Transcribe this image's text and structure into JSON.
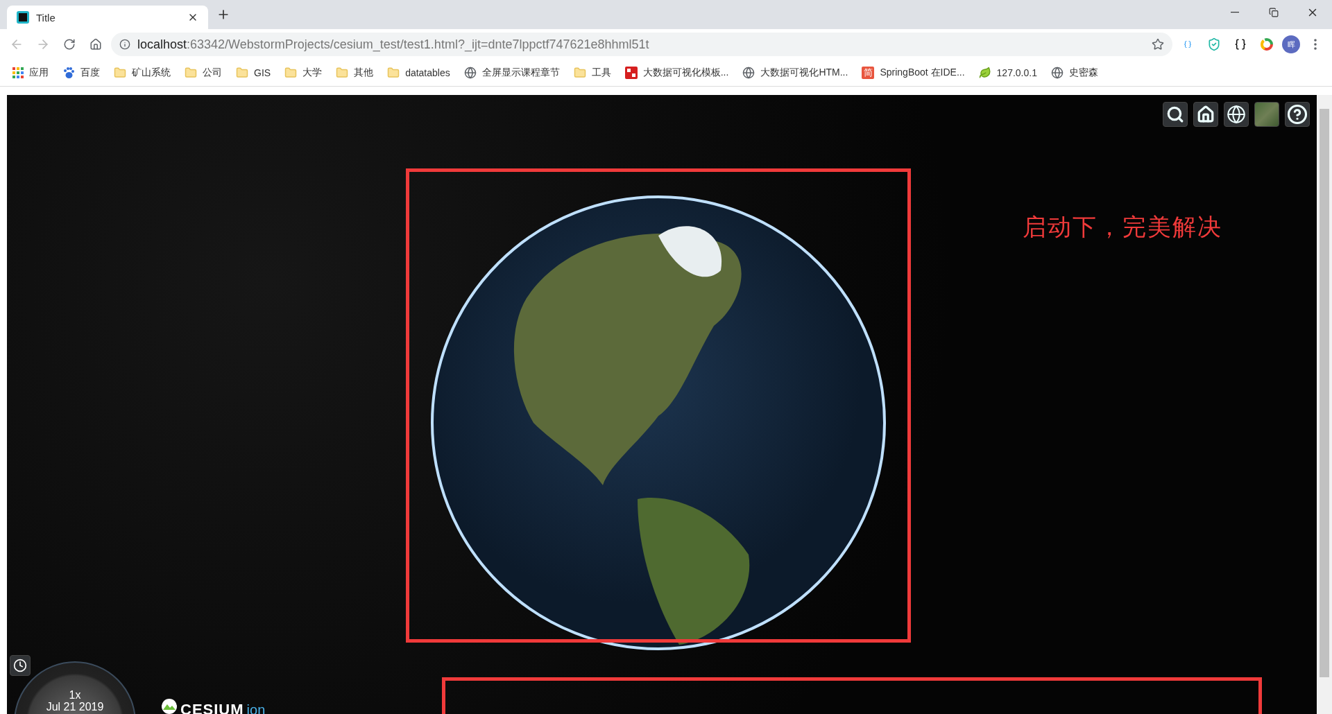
{
  "browser": {
    "tab": {
      "title": "Title",
      "selected": true
    },
    "address": {
      "host": "localhost",
      "path": ":63342/WebstormProjects/cesium_test/test1.html?_ijt=dnte7lppctf747621e8hhml51t"
    },
    "profile": {
      "initial": "晖"
    },
    "bookmarks": [
      {
        "kind": "apps",
        "label": "应用"
      },
      {
        "kind": "paw",
        "label": "百度"
      },
      {
        "kind": "folder",
        "label": "矿山系统"
      },
      {
        "kind": "folder",
        "label": "公司"
      },
      {
        "kind": "folder",
        "label": "GIS"
      },
      {
        "kind": "folder",
        "label": "大学"
      },
      {
        "kind": "folder",
        "label": "其他"
      },
      {
        "kind": "folder",
        "label": "datatables"
      },
      {
        "kind": "globe",
        "label": "全屏显示课程章节"
      },
      {
        "kind": "folder",
        "label": "工具"
      },
      {
        "kind": "stamp",
        "label": "大数据可视化模板..."
      },
      {
        "kind": "globe",
        "label": "大数据可视化HTM..."
      },
      {
        "kind": "jian",
        "label": "SpringBoot 在IDE...",
        "glyph": "简"
      },
      {
        "kind": "leaf",
        "label": "127.0.0.1"
      },
      {
        "kind": "globe",
        "label": "史密森"
      }
    ]
  },
  "viewer": {
    "annotation": "启动下，完美解决",
    "clock": {
      "speed": "1x",
      "date": "Jul 21 2019"
    },
    "logo": {
      "name": "CESIUM",
      "suffix": "ion"
    }
  }
}
